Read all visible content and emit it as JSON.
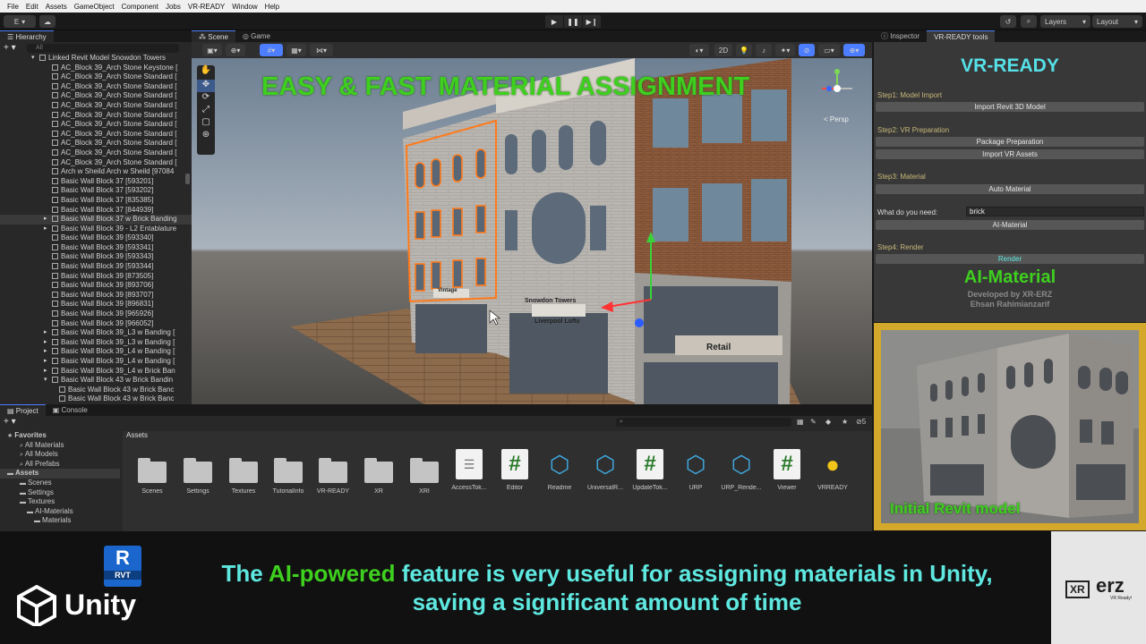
{
  "menu": [
    "File",
    "Edit",
    "Assets",
    "GameObject",
    "Component",
    "Jobs",
    "VR-READY",
    "Window",
    "Help"
  ],
  "toolbar": {
    "account": "E",
    "layers": "Layers",
    "layout": "Layout"
  },
  "hierarchy": {
    "tab": "Hierarchy",
    "search": "All",
    "rows": [
      "Linked Revit Model Snowdon Towers",
      "AC_Block 39_Arch Stone Keystone [",
      "AC_Block 39_Arch Stone Standard [",
      "AC_Block 39_Arch Stone Standard [",
      "AC_Block 39_Arch Stone Standard [",
      "AC_Block 39_Arch Stone Standard [",
      "AC_Block 39_Arch Stone Standard [",
      "AC_Block 39_Arch Stone Standard [",
      "AC_Block 39_Arch Stone Standard [",
      "AC_Block 39_Arch Stone Standard [",
      "AC_Block 39_Arch Stone Standard [",
      "AC_Block 39_Arch Stone Standard [",
      "Arch w Sheild Arch w Sheild [97084",
      "Basic Wall Block 37 [593201]",
      "Basic Wall Block 37 [593202]",
      "Basic Wall Block 37 [835385]",
      "Basic Wall Block 37 [844939]",
      "Basic Wall Block 37 w Brick Banding",
      "Basic Wall Block 39 - L2 Entablature",
      "Basic Wall Block 39 [593340]",
      "Basic Wall Block 39 [593341]",
      "Basic Wall Block 39 [593343]",
      "Basic Wall Block 39 [593344]",
      "Basic Wall Block 39 [873505]",
      "Basic Wall Block 39 [893706]",
      "Basic Wall Block 39 [893707]",
      "Basic Wall Block 39 [896831]",
      "Basic Wall Block 39 [965926]",
      "Basic Wall Block 39 [966052]",
      "Basic Wall Block 39_L3 w Banding [",
      "Basic Wall Block 39_L3 w Banding [",
      "Basic Wall Block 39_L4 w Banding [",
      "Basic Wall Block 39_L4 w Banding [",
      "Basic Wall Block 39_L4 w Brick Ban",
      "Basic Wall Block 43 w Brick Bandin",
      "Basic Wall Block 43 w Brick Banc",
      "Basic Wall Block 43 w Brick Banc"
    ]
  },
  "scene": {
    "tab_scene": "Scene",
    "tab_game": "Game",
    "overlay_title": "EASY & FAST MATERIAL ASSIGNMENT",
    "mode_2d": "2D",
    "persp": "< Persp",
    "signs": {
      "snowdon": "Snowdon Towers",
      "liverpool": "Liverpool Lofts",
      "retail": "Retail",
      "vintage": "Vintage"
    }
  },
  "inspector": {
    "tab_inspector": "Inspector",
    "tab_vr": "VR-READY tools",
    "title": "VR-READY",
    "step1": "Step1: Model Import",
    "btn_import_revit": "Import Revit 3D Model",
    "step2": "Step2: VR Preparation",
    "btn_package": "Package Preparation",
    "btn_import_vr": "Import VR Assets",
    "step3": "Step3: Material",
    "btn_auto": "Auto Material",
    "need_label": "What do you need:",
    "need_value": "brick",
    "btn_ai": "AI-Material",
    "step4": "Step4: Render",
    "btn_render": "Render",
    "ai_title": "AI-Material",
    "dev1": "Developed by XR-ERZ",
    "dev2": "Ehsan Rahimianzarif"
  },
  "project": {
    "tab_project": "Project",
    "tab_console": "Console",
    "assets_header": "Assets",
    "badge": "5",
    "tree": [
      "Favorites",
      "All Materials",
      "All Models",
      "All Prefabs",
      "Assets",
      "Scenes",
      "Settings",
      "Textures",
      "AI-Materials",
      "Materials"
    ],
    "assets": [
      {
        "name": "Scenes",
        "icon": "folder"
      },
      {
        "name": "Settings",
        "icon": "folder"
      },
      {
        "name": "Textures",
        "icon": "folder"
      },
      {
        "name": "TutorialInfo",
        "icon": "folder"
      },
      {
        "name": "VR-READY",
        "icon": "folder"
      },
      {
        "name": "XR",
        "icon": "folder"
      },
      {
        "name": "XRI",
        "icon": "folder"
      },
      {
        "name": "AccessTok...",
        "icon": "doc"
      },
      {
        "name": "Editor",
        "icon": "hash"
      },
      {
        "name": "Readme",
        "icon": "cube"
      },
      {
        "name": "UniversalR...",
        "icon": "cube"
      },
      {
        "name": "UpdateTok...",
        "icon": "hash"
      },
      {
        "name": "URP",
        "icon": "cube"
      },
      {
        "name": "URP_Rende...",
        "icon": "cube"
      },
      {
        "name": "Viewer",
        "icon": "hash"
      },
      {
        "name": "VRREADY",
        "icon": "bulb"
      }
    ]
  },
  "thumbnail": {
    "label": "Initial Revit model"
  },
  "caption": {
    "part1": "The ",
    "highlight": "AI-powered",
    "part2": " feature is very useful for assigning materials in Unity,",
    "line2": "saving a significant amount of time",
    "rvt": "RVT",
    "rvt_letter": "R",
    "unity": "Unity",
    "xr": "XR",
    "erz": "erz",
    "erz_sub": "VR Ready!"
  },
  "colors": {
    "accent_green": "#3ecf1f",
    "cyan": "#5ee8e0",
    "vr_title": "#56e0e8",
    "gold": "#d4a82a"
  }
}
